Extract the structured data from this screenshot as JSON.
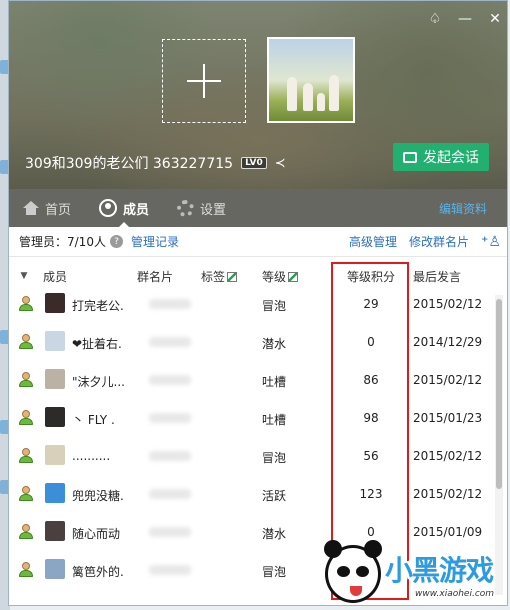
{
  "window": {
    "group_title": "309和309的老公们 363227715",
    "level_badge": "LV0",
    "start_chat_label": "发起会话"
  },
  "nav": {
    "tabs": [
      {
        "label": "首页",
        "icon": "home-icon"
      },
      {
        "label": "成员",
        "icon": "member-icon",
        "active": true
      },
      {
        "label": "设置",
        "icon": "gear-icon"
      }
    ],
    "edit_data_label": "编辑资料"
  },
  "admin_bar": {
    "admins_label": "管理员：7/10人",
    "manage_log_label": "管理记录",
    "advanced_manage_label": "高级管理",
    "edit_card_label": "修改群名片"
  },
  "table": {
    "headers": {
      "member": "成员",
      "group_card": "群名片",
      "tag": "标签",
      "level": "等级",
      "level_points": "等级积分",
      "last_speak": "最后发言"
    },
    "rows": [
      {
        "name": "打完老公.",
        "level": "冒泡",
        "points": "29",
        "last": "2015/02/12",
        "avatar_color": "#3a2a2a"
      },
      {
        "name": "❤扯着右.",
        "level": "潜水",
        "points": "0",
        "last": "2014/12/29",
        "avatar_color": "#c9d6e4"
      },
      {
        "name": "\"沫夕儿...",
        "level": "吐槽",
        "points": "86",
        "last": "2015/02/12",
        "avatar_color": "#b9b2a5"
      },
      {
        "name": "丶 FLY .",
        "level": "吐槽",
        "points": "98",
        "last": "2015/01/23",
        "avatar_color": "#2d2a2a"
      },
      {
        "name": "..........",
        "level": "冒泡",
        "points": "56",
        "last": "2015/02/12",
        "avatar_color": "#d8d0b8"
      },
      {
        "name": "兜兜没糖.",
        "level": "活跃",
        "points": "123",
        "last": "2015/02/12",
        "avatar_color": "#3b8ed8"
      },
      {
        "name": "随心而动",
        "level": "潜水",
        "points": "0",
        "last": "2015/01/09",
        "avatar_color": "#4a4040"
      },
      {
        "name": "篱笆外的.",
        "level": "冒泡",
        "points": "",
        "last": "",
        "avatar_color": "#8aa6c4"
      }
    ]
  },
  "watermark": {
    "logo_text": "小黑游戏",
    "url": "www.xiaohei.com"
  }
}
